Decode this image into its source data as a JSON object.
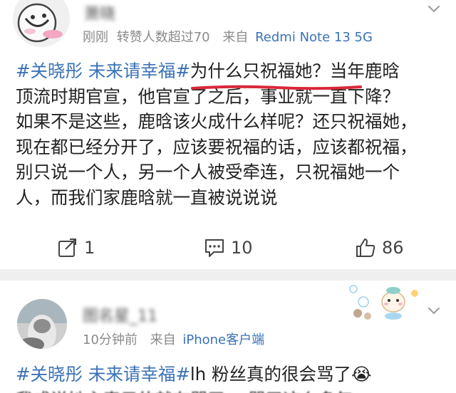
{
  "post1": {
    "username": "萧晓",
    "meta": {
      "time": "刚刚",
      "likes_note": "转赞人数超过70",
      "from_label": "来自",
      "source": "Redmi Note 13 5G"
    },
    "content": {
      "tag": "#关晓彤 未来请幸福#",
      "line1_rest": "为什么只祝福她？当年鹿晗",
      "lines": [
        "顶流时期官宣，他官宣了之后，事业就一直下降？",
        "如果不是这些，鹿晗该火成什么样呢？还只祝福她，",
        "现在都已经分开了，应该要祝福的话，应该都祝福，",
        "别只说一个人，另一个人被受牵连，只祝福她一个",
        "人，而我们家鹿晗就一直被说说说"
      ]
    },
    "actions": {
      "share_count": "1",
      "comment_count": "10",
      "like_count": "86"
    }
  },
  "post2": {
    "username": "图名星_11",
    "meta": {
      "time": "10分钟前",
      "from_label": "来自",
      "source": "iPhone客户端"
    },
    "content": {
      "tag": "#关晓彤 未来请幸福#",
      "line1_rest": "lh 粉丝真的很会骂了",
      "emoji": "😭",
      "line2": "我成说她主表示的就在骂了 一骂了这么多年"
    }
  },
  "colors": {
    "link": "#3a72b8",
    "underline": "#d9283a",
    "separator": "#efefef"
  }
}
